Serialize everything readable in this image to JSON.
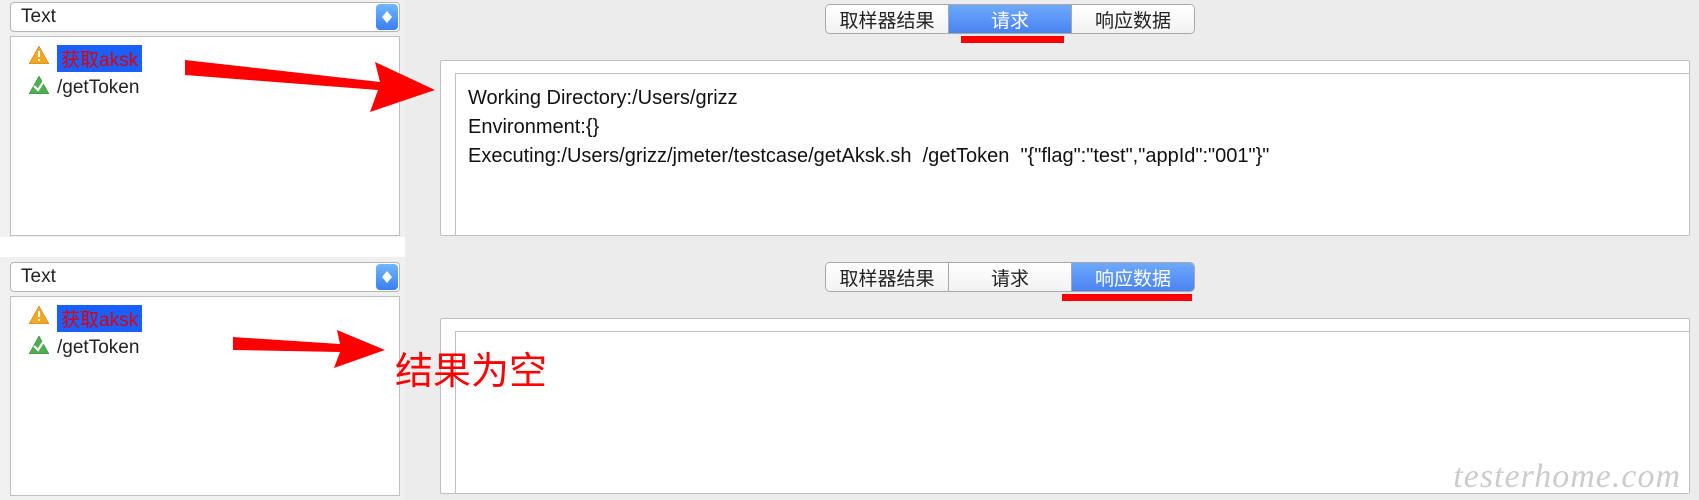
{
  "panes": {
    "top": {
      "dropdown_value": "Text",
      "tree": [
        {
          "label": "获取aksk",
          "selected": true,
          "icon": "warn"
        },
        {
          "label": "/getToken",
          "selected": false,
          "icon": "ok"
        }
      ],
      "tabs": {
        "sampler": "取样器结果",
        "request": "请求",
        "response": "响应数据",
        "active": "request"
      },
      "content": "Working Directory:/Users/grizz\nEnvironment:{}\nExecuting:/Users/grizz/jmeter/testcase/getAksk.sh  /getToken  \"{\"flag\":\"test\",\"appId\":\"001\"}\""
    },
    "bottom": {
      "dropdown_value": "Text",
      "tree": [
        {
          "label": "获取aksk",
          "selected": true,
          "icon": "warn"
        },
        {
          "label": "/getToken",
          "selected": false,
          "icon": "ok"
        }
      ],
      "tabs": {
        "sampler": "取样器结果",
        "request": "请求",
        "response": "响应数据",
        "active": "response"
      },
      "content": ""
    }
  },
  "annotation": "结果为空",
  "watermark": "testerhome.com"
}
